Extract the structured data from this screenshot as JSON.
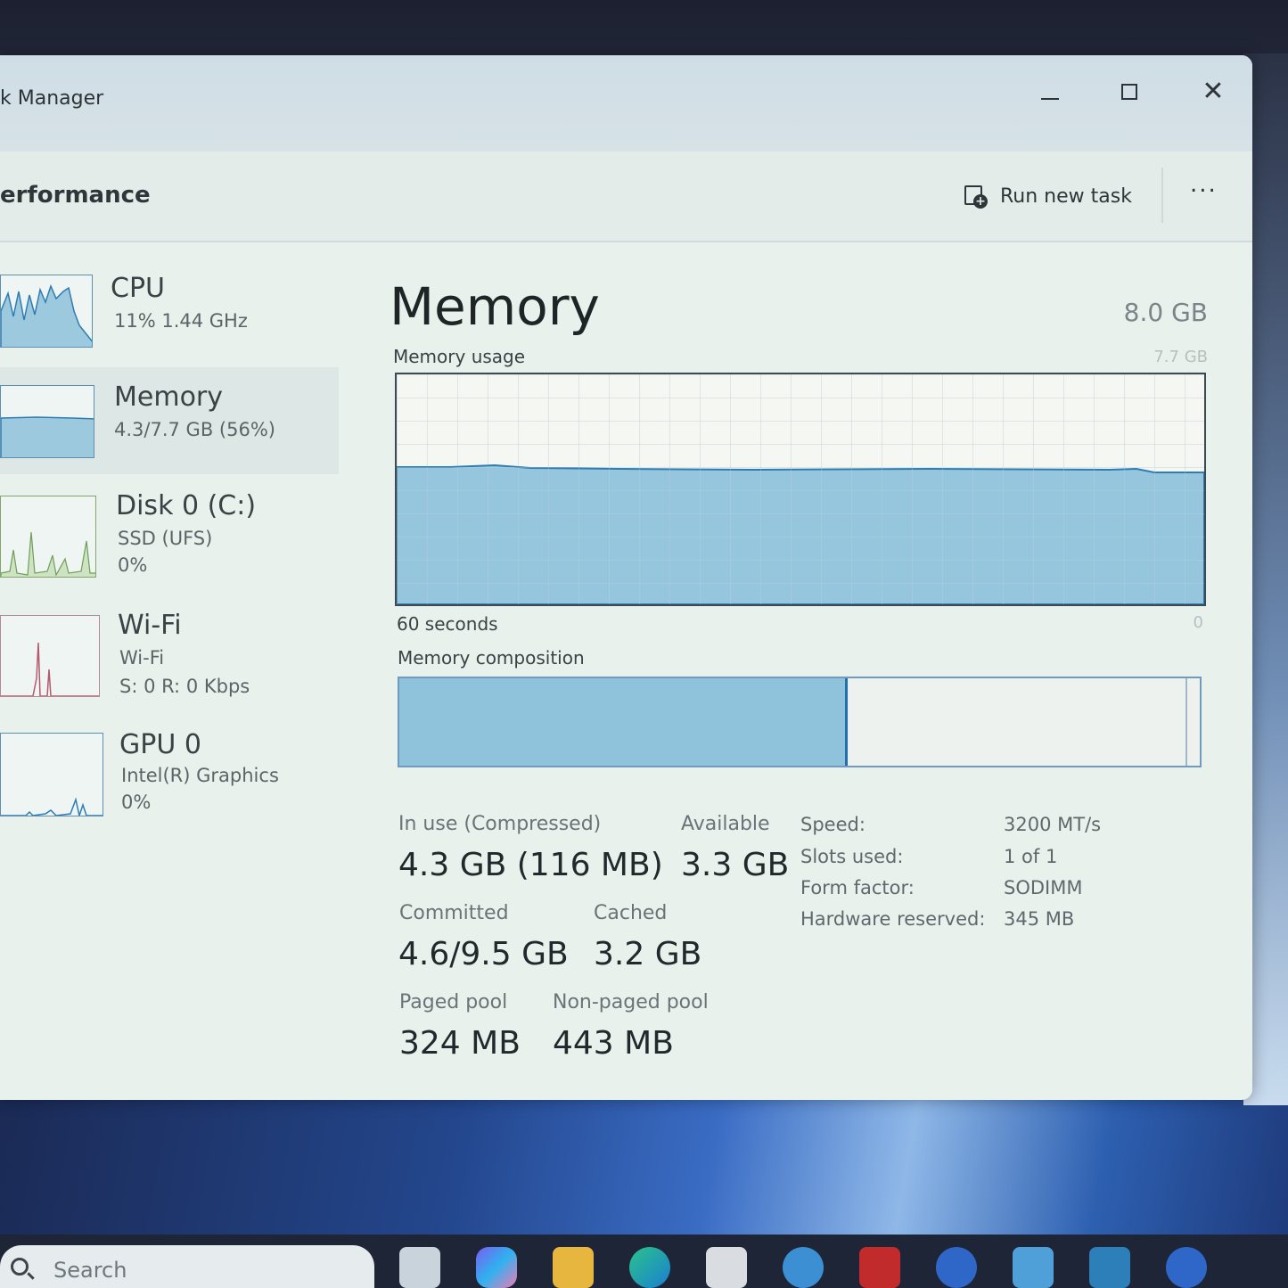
{
  "window": {
    "title": "k Manager",
    "page_heading": "erformance",
    "run_new_task": "Run new task",
    "more": "..."
  },
  "sidebar": {
    "items": [
      {
        "name": "CPU",
        "line1": "11%  1.44 GHz",
        "line2": ""
      },
      {
        "name": "Memory",
        "line1": "4.3/7.7 GB (56%)",
        "line2": ""
      },
      {
        "name": "Disk 0 (C:)",
        "line1": "SSD (UFS)",
        "line2": "0%"
      },
      {
        "name": "Wi-Fi",
        "line1": "Wi-Fi",
        "line2": "S: 0  R: 0 Kbps"
      },
      {
        "name": "GPU 0",
        "line1": "Intel(R) Graphics",
        "line2": "0%"
      }
    ]
  },
  "main": {
    "title": "Memory",
    "total": "8.0 GB",
    "usage_label": "Memory usage",
    "usage_max": "7.7 GB",
    "time_label": "60 seconds",
    "time_end": "0",
    "composition_label": "Memory composition",
    "in_use_fraction": 0.56,
    "stats": {
      "in_use_label": "In use (Compressed)",
      "in_use_value": "4.3 GB (116 MB)",
      "available_label": "Available",
      "available_value": "3.3 GB",
      "committed_label": "Committed",
      "committed_value": "4.6/9.5 GB",
      "cached_label": "Cached",
      "cached_value": "3.2 GB",
      "paged_label": "Paged pool",
      "paged_value": "324 MB",
      "nonpaged_label": "Non-paged pool",
      "nonpaged_value": "443 MB"
    },
    "specs": [
      {
        "label": "Speed:",
        "value": "3200 MT/s"
      },
      {
        "label": "Slots used:",
        "value": "1 of 1"
      },
      {
        "label": "Form factor:",
        "value": "SODIMM"
      },
      {
        "label": "Hardware reserved:",
        "value": "345 MB"
      }
    ]
  },
  "taskbar": {
    "search_placeholder": "Search"
  },
  "colors": {
    "graph_fill": "#8fc3dc",
    "graph_line": "#2f7cb3",
    "accent": "#1f6fb2"
  }
}
